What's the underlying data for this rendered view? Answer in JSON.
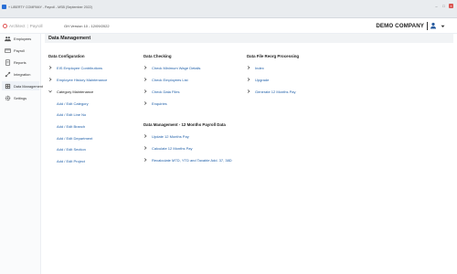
{
  "window": {
    "title": "+ LIBERTY COMPANY - Payroll - MSB (September 2022)",
    "controls": [
      "–",
      "□",
      "×"
    ]
  },
  "header": {
    "brand_name": "Architect",
    "brand_sep": "|",
    "brand_app": "Payroll",
    "period": "GH Version 10 - 12/09/2022",
    "company": "DEMO COMPANY"
  },
  "sidebar": {
    "items": [
      {
        "label": "Employees",
        "icon": "people-icon"
      },
      {
        "label": "Payroll",
        "icon": "payroll-icon"
      },
      {
        "label": "Reports",
        "icon": "reports-icon"
      },
      {
        "label": "Integration",
        "icon": "integration-icon"
      },
      {
        "label": "Data Management",
        "icon": "database-icon"
      },
      {
        "label": "Settings",
        "icon": "gear-icon"
      }
    ]
  },
  "main": {
    "title": "Data Management",
    "sections": {
      "config": {
        "title": "Data Configuration",
        "items": [
          "EIS Employee Contributions",
          "Employee History Maintenance",
          "Category Maintenance"
        ],
        "sub_items": [
          "Add / Edit Category",
          "Add / Edit Line No",
          "Add / Edit Branch",
          "Add / Edit Department",
          "Add / Edit Section",
          "Add / Edit Project"
        ]
      },
      "checking": {
        "title": "Data Checking",
        "items": [
          "Check Minimum Wage Details",
          "Check Employees List",
          "Check Data Files",
          "Enquiries"
        ]
      },
      "reorg": {
        "title": "Data File Reorg Processing",
        "items": [
          "Index",
          "Upgrade",
          "Generate 12 Months Pay"
        ]
      },
      "twelve": {
        "title": "Data Management - 12 Months Payroll Data",
        "items": [
          "Update 12 Months Pay",
          "Calculate 12 Months Pay",
          "Recalculate MTD, YTD and Taxable Add. 37, 38D"
        ]
      }
    }
  },
  "colors": {
    "link": "#1f5fa8",
    "active_bg": "#eef2f7",
    "brand": "#e05555"
  }
}
